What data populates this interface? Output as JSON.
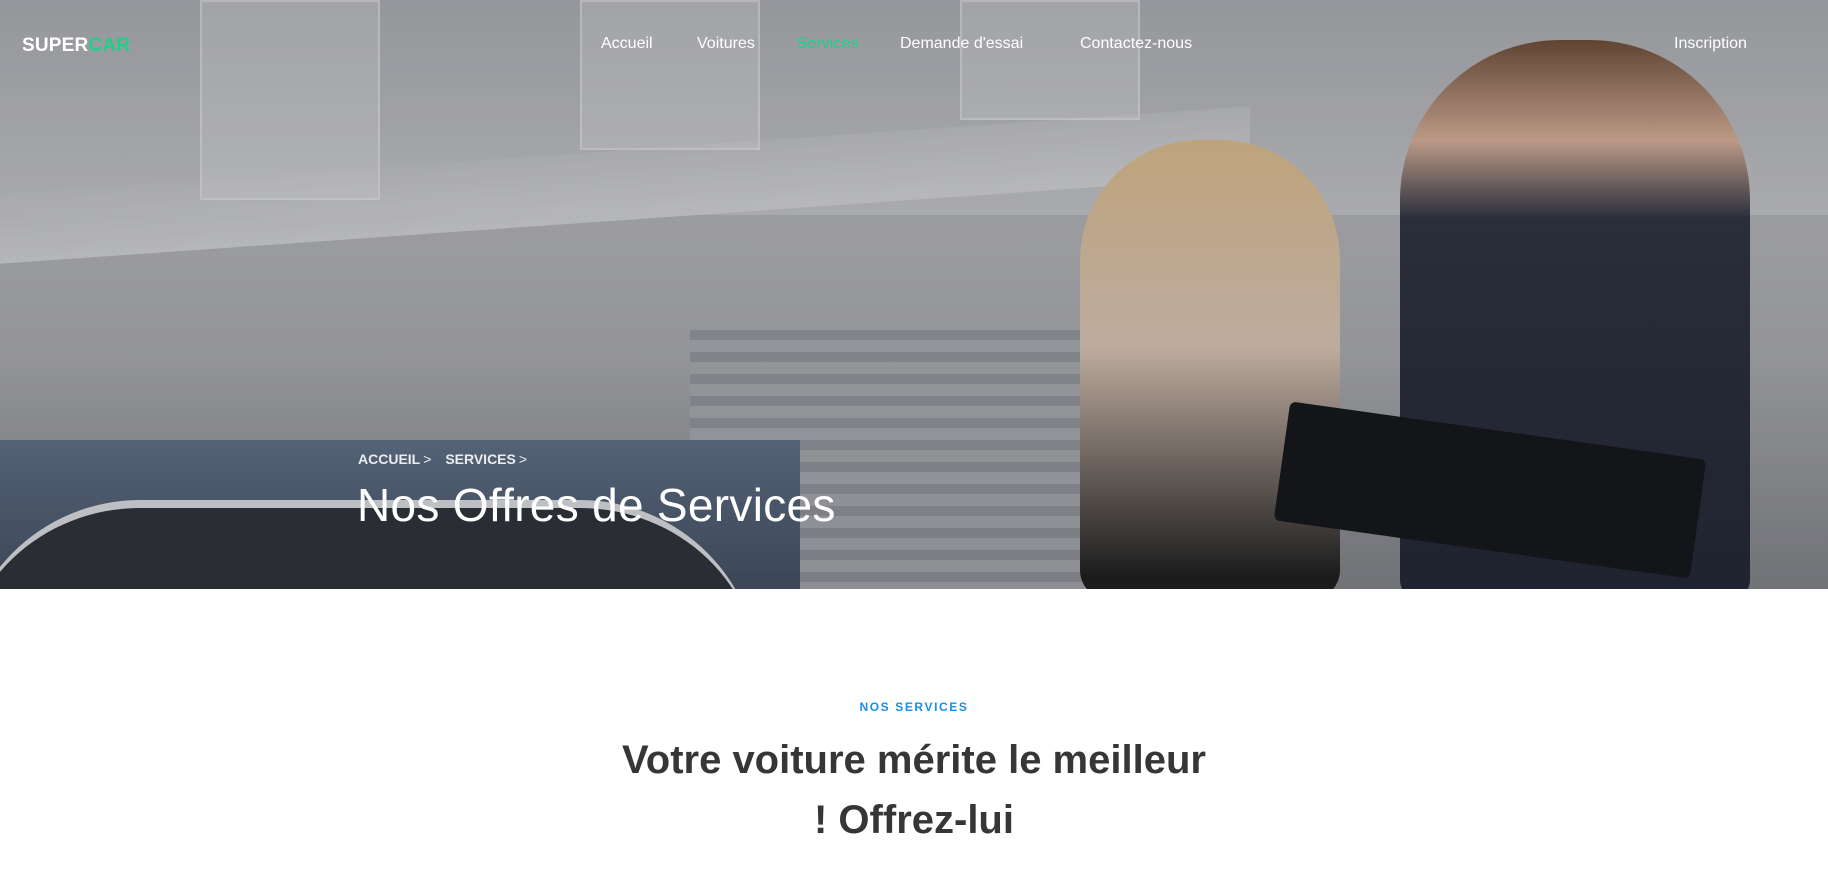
{
  "brand": {
    "logo_part1": "SUPER",
    "logo_part2": "CAR",
    "accent_color": "#1ed08c"
  },
  "nav": {
    "items": [
      {
        "label": "Accueil",
        "active": false
      },
      {
        "label": "Voitures",
        "active": false
      },
      {
        "label": "Services",
        "active": true
      },
      {
        "label": "Demande d'essai",
        "active": false
      },
      {
        "label": "Contactez-nous",
        "active": false
      }
    ],
    "signup_label": "Inscription"
  },
  "hero": {
    "breadcrumb": [
      {
        "label": "ACCUEIL",
        "sep": ">"
      },
      {
        "label": "SERVICES",
        "sep": ">"
      }
    ],
    "title": "Nos Offres de Services"
  },
  "services": {
    "eyebrow": "NOS SERVICES",
    "eyebrow_color": "#1a8fe3",
    "headline_line1": "Votre voiture mérite le meilleur",
    "headline_line2": "! Offrez-lui"
  }
}
